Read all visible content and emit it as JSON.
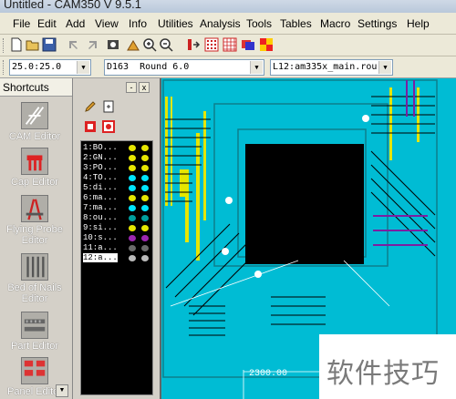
{
  "window": {
    "title": "Untitled - CAM350 V 9.5.1"
  },
  "menu": [
    "File",
    "Edit",
    "Add",
    "View",
    "Info",
    "Utilities",
    "Analysis",
    "Tools",
    "Tables",
    "Macro",
    "Settings",
    "Help"
  ],
  "toolbar": {
    "icons": [
      "new-file-icon",
      "open-file-icon",
      "save-icon",
      "undo-icon",
      "redo-icon",
      "redraw-icon",
      "clear-icon",
      "zoom-in-icon",
      "zoom-out-icon",
      "pan-icon",
      "grid-icon",
      "grid-alt-icon",
      "layers-icon",
      "colors-icon"
    ]
  },
  "combos": {
    "grid": "25.0:25.0",
    "dcode": "D163  Round 6.0",
    "layer": "L12:am335x_main.rou"
  },
  "shortcuts": {
    "header": "Shortcuts",
    "items": [
      {
        "label": "CAM Editor",
        "icon": "cam-editor-icon"
      },
      {
        "label": "Cap Editor",
        "icon": "cap-editor-icon"
      },
      {
        "label": "Flying Probe Editor",
        "icon": "flying-probe-icon"
      },
      {
        "label": "Bed of Nails Editor",
        "icon": "bed-of-nails-icon"
      },
      {
        "label": "Part Editor",
        "icon": "part-editor-icon"
      },
      {
        "label": "Panel Editor",
        "icon": "panel-editor-icon"
      }
    ]
  },
  "layer_panel": {
    "min_button": "-",
    "close_button": "x",
    "layers": [
      {
        "label": "1:BO...",
        "color": "#e6e600"
      },
      {
        "label": "2:GN...",
        "color": "#e6e600"
      },
      {
        "label": "3:PO...",
        "color": "#e6e600"
      },
      {
        "label": "4:TO...",
        "color": "#00e5ff"
      },
      {
        "label": "5:di...",
        "color": "#00e5ff"
      },
      {
        "label": "6:ma...",
        "color": "#e6e600"
      },
      {
        "label": "7:ma...",
        "color": "#00e5ff"
      },
      {
        "label": "8:ou...",
        "color": "#009e9e"
      },
      {
        "label": "9:si...",
        "color": "#e6e600"
      },
      {
        "label": "10:s...",
        "color": "#9c27b0"
      },
      {
        "label": "11:a...",
        "color": "#6a6a6a"
      },
      {
        "label": "12:a...",
        "color": "#bbbbbb"
      }
    ],
    "active_index": 11
  },
  "canvas": {
    "dimension_label": "2300.00"
  },
  "watermark": "软件技巧"
}
